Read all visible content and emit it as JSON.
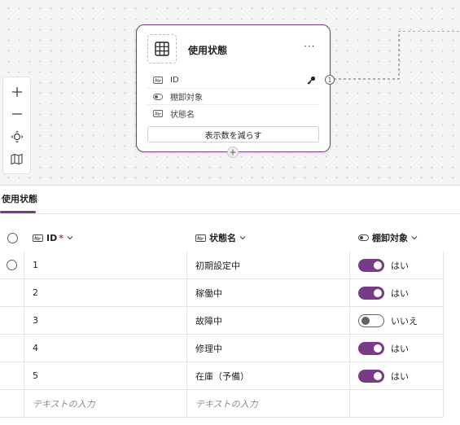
{
  "diagram": {
    "entity": {
      "title": "使用状態",
      "more_label": "···",
      "fields": [
        {
          "label": "ID",
          "type_icon": "text-field-icon",
          "is_key": true
        },
        {
          "label": "棚卸対象",
          "type_icon": "toggle-field-icon",
          "is_key": false
        },
        {
          "label": "状態名",
          "type_icon": "text-field-icon",
          "is_key": false
        }
      ],
      "show_less_label": "表示数を減らす",
      "relationship_badge": "1"
    },
    "toolbar": {
      "zoom_in_icon": "plus-icon",
      "zoom_out_icon": "minus-icon",
      "fit_icon": "fit-view-icon",
      "map_icon": "map-icon"
    }
  },
  "tab": {
    "label": "使用状態"
  },
  "grid": {
    "columns": [
      {
        "label": "ID",
        "required": "*",
        "icon": "text-field-icon"
      },
      {
        "label": "状態名",
        "icon": "text-field-icon"
      },
      {
        "label": "棚卸対象",
        "icon": "toggle-field-icon"
      }
    ],
    "rows": [
      {
        "id": "1",
        "name": "初期設定中",
        "inventory": "はい",
        "on": true
      },
      {
        "id": "2",
        "name": "稼働中",
        "inventory": "はい",
        "on": true
      },
      {
        "id": "3",
        "name": "故障中",
        "inventory": "いいえ",
        "on": false
      },
      {
        "id": "4",
        "name": "修理中",
        "inventory": "はい",
        "on": true
      },
      {
        "id": "5",
        "name": "在庫（予備）",
        "inventory": "はい",
        "on": true
      }
    ],
    "new_row_placeholder": "テキストの入力",
    "accent_color": "#7a3b86"
  }
}
